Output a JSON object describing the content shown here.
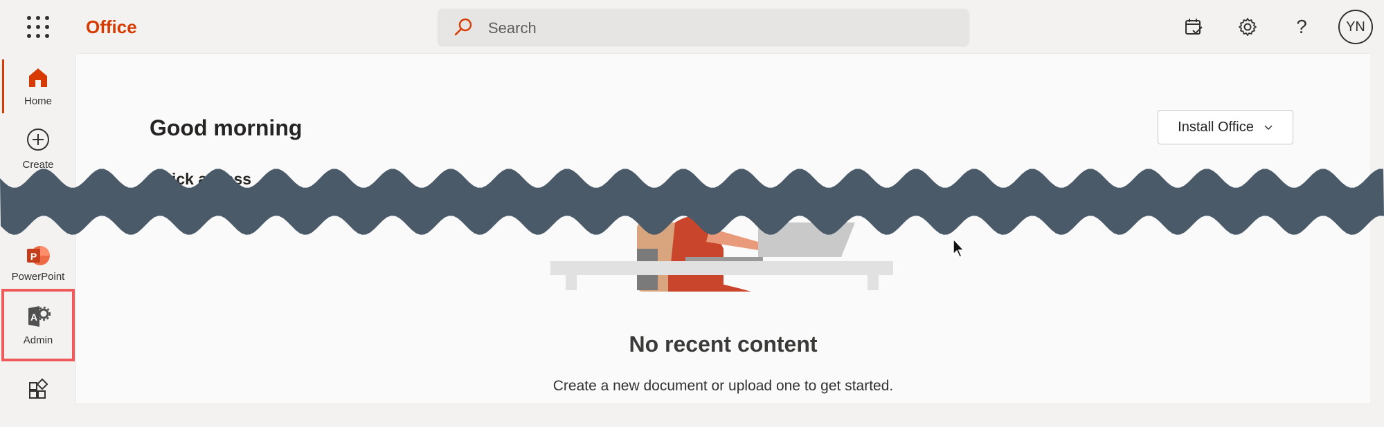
{
  "app": {
    "brand": "Office"
  },
  "search": {
    "placeholder": "Search"
  },
  "header": {
    "avatar_initials": "YN"
  },
  "rail": {
    "items": [
      {
        "label": "Home"
      },
      {
        "label": "Create"
      },
      {
        "label": "PowerPoint"
      },
      {
        "label": "Admin"
      }
    ]
  },
  "main": {
    "greeting": "Good morning",
    "install_label": "Install Office",
    "quick_access": "Quick access",
    "empty_title": "No recent content",
    "empty_sub": "Create a new document or upload one to get started."
  },
  "colors": {
    "accent": "#d83b01",
    "highlight": "#ef5b5b",
    "wave": "#4a5a68"
  }
}
